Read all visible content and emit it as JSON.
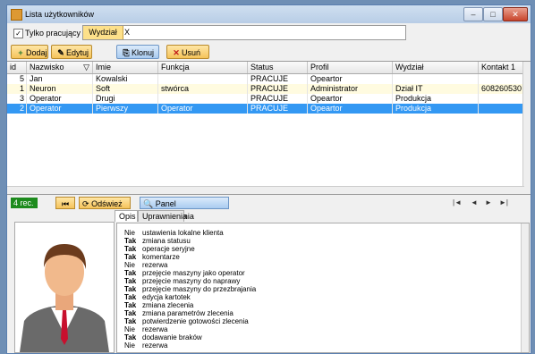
{
  "window": {
    "title": "Lista użytkowników"
  },
  "filter": {
    "checkbox_label": "Tylko pracujący",
    "checkbox_checked": true,
    "tag_label": "Wydział",
    "tag_value": "X"
  },
  "toolbar": {
    "add": "Dodaj",
    "edit": "Edytuj",
    "clone": "Klonuj",
    "delete": "Usuń"
  },
  "table": {
    "headers": [
      "id",
      "Nazwisko",
      "Imie",
      "Funkcja",
      "Status",
      "Profil",
      "Wydział",
      "Kontakt 1"
    ],
    "rows": [
      {
        "id": "5",
        "nazwisko": "Jan",
        "imie": "Kowalski",
        "funkcja": "",
        "status": "PRACUJE",
        "profil": "Opeartor",
        "wydzial": "",
        "kontakt": ""
      },
      {
        "id": "1",
        "nazwisko": "Neuron",
        "imie": "Soft",
        "funkcja": "stwórca",
        "status": "PRACUJE",
        "profil": "Administrator",
        "wydzial": "Dział IT",
        "kontakt": "608260530"
      },
      {
        "id": "3",
        "nazwisko": "Operator",
        "imie": "Drugi",
        "funkcja": "",
        "status": "PRACUJE",
        "profil": "Opeartor",
        "wydzial": "Produkcja",
        "kontakt": ""
      },
      {
        "id": "2",
        "nazwisko": "Operator",
        "imie": "Pierwszy",
        "funkcja": "Operator",
        "status": "PRACUJE",
        "profil": "Opeartor",
        "wydzial": "Produkcja",
        "kontakt": ""
      }
    ]
  },
  "status": {
    "count": "4 rec.",
    "refresh": "Odśwież",
    "search_panel": "Panel Wyszukiwania"
  },
  "tabs": [
    "Opis",
    "Uprawnienia"
  ],
  "permissions": [
    {
      "v": "Nie",
      "t": "ustawienia lokalne klienta"
    },
    {
      "v": "Tak",
      "t": "zmiana statusu"
    },
    {
      "v": "Tak",
      "t": "operacje seryjne"
    },
    {
      "v": "Tak",
      "t": "komentarze"
    },
    {
      "v": "Nie",
      "t": "rezerwa"
    },
    {
      "v": "Tak",
      "t": "przejęcie maszyny jako operator"
    },
    {
      "v": "Tak",
      "t": "przejęcie maszyny do naprawy"
    },
    {
      "v": "Tak",
      "t": "przejęcie maszyny do przezbrajania"
    },
    {
      "v": "Tak",
      "t": "edycja kartotek"
    },
    {
      "v": "Tak",
      "t": "zmiana zlecenia"
    },
    {
      "v": "Tak",
      "t": "zmiana parametrów zlecenia"
    },
    {
      "v": "Tak",
      "t": "potwierdzenie gotowości zlecenia"
    },
    {
      "v": "Nie",
      "t": "rezerwa"
    },
    {
      "v": "Tak",
      "t": "dodawanie braków"
    },
    {
      "v": "Nie",
      "t": "rezerwa"
    }
  ],
  "colors": {
    "selected_row": "#3398f3",
    "count_badge": "#1d8b1d",
    "button_orange": "#f5c35a"
  }
}
